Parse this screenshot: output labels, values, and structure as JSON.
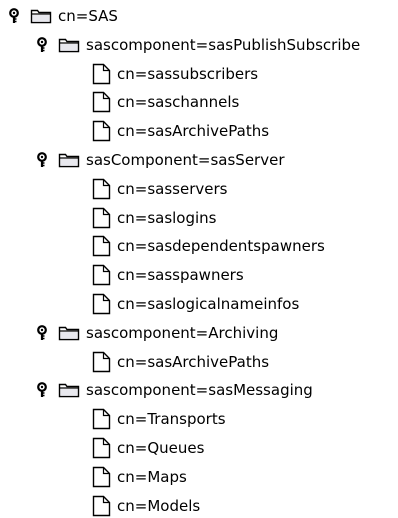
{
  "tree": {
    "root": {
      "label": "cn=SAS",
      "icon": "folder-icon",
      "expanded": true,
      "children": [
        {
          "label": "sascomponent=sasPublishSubscribe",
          "icon": "folder-icon",
          "expanded": true,
          "children": [
            {
              "label": "cn=sassubscribers",
              "icon": "document-icon"
            },
            {
              "label": "cn=saschannels",
              "icon": "document-icon"
            },
            {
              "label": "cn=sasArchivePaths",
              "icon": "document-icon"
            }
          ]
        },
        {
          "label": "sasComponent=sasServer",
          "icon": "folder-icon",
          "expanded": true,
          "children": [
            {
              "label": "cn=sasservers",
              "icon": "document-icon"
            },
            {
              "label": "cn=saslogins",
              "icon": "document-icon"
            },
            {
              "label": "cn=sasdependentspawners",
              "icon": "document-icon"
            },
            {
              "label": "cn=sasspawners",
              "icon": "document-icon"
            },
            {
              "label": "cn=saslogicalnameinfos",
              "icon": "document-icon"
            }
          ]
        },
        {
          "label": "sascomponent=Archiving",
          "icon": "folder-icon",
          "expanded": true,
          "children": [
            {
              "label": "cn=sasArchivePaths",
              "icon": "document-icon"
            }
          ]
        },
        {
          "label": "sascomponent=sasMessaging",
          "icon": "folder-icon",
          "expanded": true,
          "children": [
            {
              "label": "cn=Transports",
              "icon": "document-icon"
            },
            {
              "label": "cn=Queues",
              "icon": "document-icon"
            },
            {
              "label": "cn=Maps",
              "icon": "document-icon"
            },
            {
              "label": "cn=Models",
              "icon": "document-icon"
            }
          ]
        }
      ]
    }
  },
  "colors": {
    "background": "#ffffff",
    "text": "#000000",
    "toggle": "#000000",
    "icon_outline": "#000000"
  }
}
